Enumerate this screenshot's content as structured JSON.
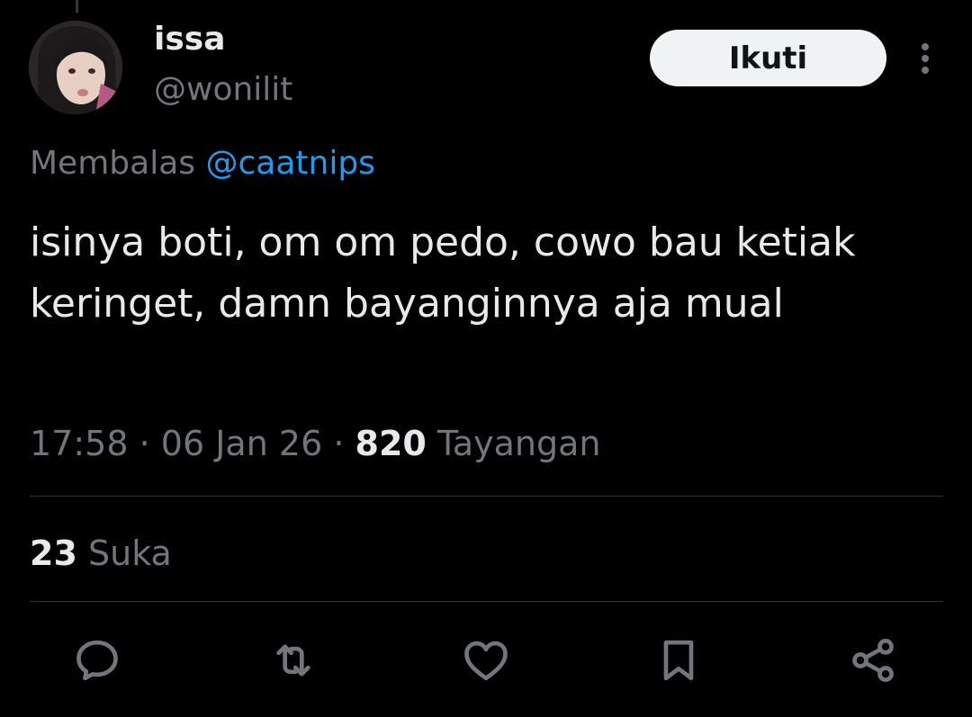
{
  "author": {
    "name": "issa",
    "handle": "@wonilit"
  },
  "follow_label": "Ikuti",
  "more_icon": "more-vertical-icon",
  "reply_prefix": "Membalas",
  "reply_mention": "@caatnips",
  "tweet_text": "isinya boti, om om pedo, cowo bau ketiak keringet, damn bayanginnya aja mual",
  "meta": {
    "time": "17:58",
    "date": "06 Jan 26",
    "views_count": "820",
    "views_label": "Tayangan"
  },
  "likes": {
    "count": "23",
    "label": "Suka"
  },
  "actions": [
    "reply-icon",
    "retweet-icon",
    "like-icon",
    "bookmark-icon",
    "share-icon"
  ],
  "colors": {
    "background": "#000000",
    "text": "#e7e9ea",
    "secondary": "#71767b",
    "mention": "#1d9bf0",
    "button_bg": "#eff3f4"
  }
}
